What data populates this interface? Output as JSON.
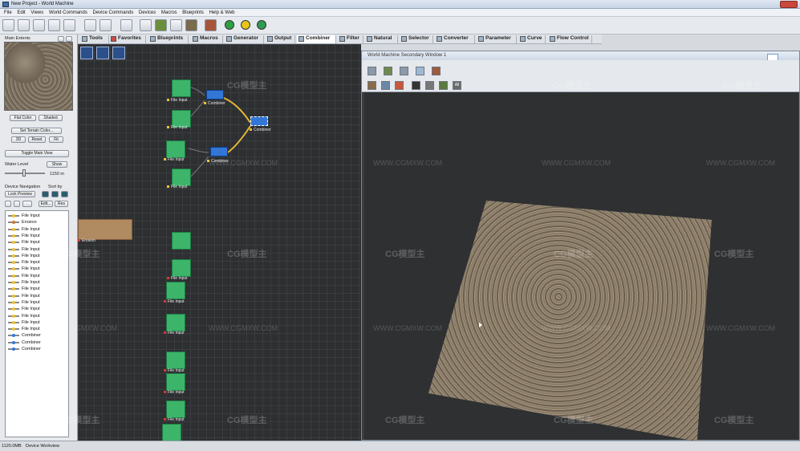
{
  "window": {
    "title": "New Project - World Machine"
  },
  "menu": [
    "File",
    "Edit",
    "Views",
    "World Commands",
    "Device Commands",
    "Devices",
    "Macros",
    "Blueprints",
    "Help & Web"
  ],
  "tabs": [
    {
      "label": "Tools"
    },
    {
      "label": "Favorites"
    },
    {
      "label": "Blueprints"
    },
    {
      "label": "Macros"
    },
    {
      "label": "Generator"
    },
    {
      "label": "Output"
    },
    {
      "label": "Combiner"
    },
    {
      "label": "Filter"
    },
    {
      "label": "Natural"
    },
    {
      "label": "Selector"
    },
    {
      "label": "Converter"
    },
    {
      "label": "Parameter"
    },
    {
      "label": "Curve"
    },
    {
      "label": "Flow Control"
    }
  ],
  "left_panel": {
    "extents_label": "Main Extents",
    "flat_color": "Flat Color",
    "shaded": "Shaded",
    "set_terrain_color": "Set Terrain Color...",
    "btn_3d": "3D",
    "btn_reset": "Reset",
    "btn_fit": "Fit",
    "toggle_main_view": "Toggle Main View",
    "water_level": "Water Level",
    "show": "Show",
    "water_value": "1150 m",
    "device_navigation": "Device Navigation",
    "sort_by": "Sort by",
    "lock_preview": "Lock Preview",
    "edit": "Edit...",
    "res": "Res",
    "devices": [
      "File Input",
      "Erosion",
      "File Input",
      "File Input",
      "File Input",
      "File Input",
      "File Input",
      "File Input",
      "File Input",
      "File Input",
      "File Input",
      "File Input",
      "File Input",
      "File Input",
      "File Input",
      "File Input",
      "File Input",
      "File Input",
      "Combiner",
      "Combiner",
      "Combiner"
    ]
  },
  "workview": {
    "nodes": [
      "File Input",
      "File Input",
      "File Input",
      "File Input",
      "File Input",
      "File Input",
      "File Input",
      "File Input",
      "File Input",
      "File Input",
      "File Input"
    ],
    "combiner1": "Combiner",
    "combiner2": "Combiner",
    "combiner3": "Combiner",
    "erosion": "Erosion"
  },
  "secondary": {
    "title": "World Machine Secondary Window 1",
    "all_label": "All"
  },
  "status": {
    "memory": "1120.0MB",
    "mode": "Device Workview"
  },
  "watermark": {
    "logo": "CG模型主",
    "url": "WWW.CGMXW.COM"
  }
}
